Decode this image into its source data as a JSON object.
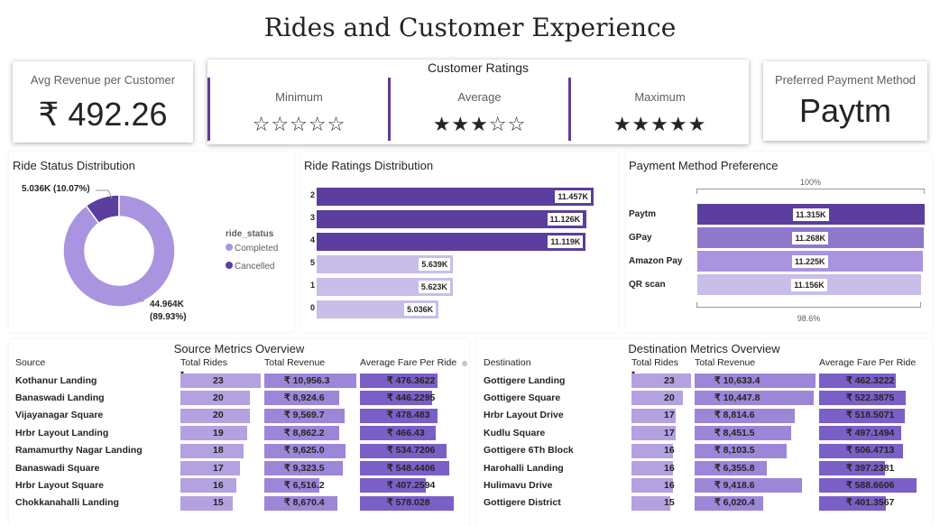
{
  "title": "Rides and Customer Experience",
  "kpi_revenue": {
    "label": "Avg Revenue per Customer",
    "value": "₹ 492.26"
  },
  "ratings": {
    "title": "Customer Ratings",
    "minimum": {
      "label": "Minimum",
      "stars": "☆☆☆☆☆",
      "rating": 0
    },
    "average": {
      "label": "Average",
      "stars": "★★★☆☆",
      "rating": 3
    },
    "maximum": {
      "label": "Maximum",
      "stars": "★★★★★",
      "rating": 5
    }
  },
  "kpi_payment": {
    "label": "Preferred Payment Method",
    "value": "Paytm"
  },
  "colors": {
    "accent": "#5e3c99",
    "dark": "#5b3e9e",
    "mid": "#8f77cc",
    "light": "#b3a1e0",
    "pale": "#c9bdea"
  },
  "chart_data": [
    {
      "type": "pie",
      "title": "Ride Status Distribution",
      "legend_title": "ride_status",
      "legend_position": "right",
      "slices": [
        {
          "name": "Completed",
          "value": 44964,
          "label": "44.964K",
          "pct": "(89.93%)",
          "color": "#a994e0"
        },
        {
          "name": "Cancelled",
          "value": 5036,
          "label": "5.036K (10.07%)",
          "color": "#5b3e9e"
        }
      ]
    },
    {
      "type": "bar",
      "title": "Ride Ratings Distribution",
      "orientation": "horizontal",
      "categories": [
        "2",
        "3",
        "4",
        "5",
        "1",
        "0"
      ],
      "values": [
        11457,
        11126,
        11119,
        5639,
        5623,
        5036
      ],
      "labels": [
        "11.457K",
        "11.126K",
        "11.119K",
        "5.639K",
        "5.623K",
        "5.036K"
      ],
      "colors": [
        "#5b3e9e",
        "#5b3e9e",
        "#5b3e9e",
        "#c9bdea",
        "#c9bdea",
        "#c9bdea"
      ],
      "xlim": [
        0,
        12000
      ]
    },
    {
      "type": "bar",
      "title": "Payment Method Preference",
      "orientation": "horizontal",
      "categories": [
        "Paytm",
        "GPay",
        "Amazon Pay",
        "QR scan"
      ],
      "values": [
        11315,
        11268,
        11225,
        11156
      ],
      "labels": [
        "11.315K",
        "11.268K",
        "11.225K",
        "11.156K"
      ],
      "colors": [
        "#5b3e9e",
        "#8f77cc",
        "#a994e0",
        "#c9bdea"
      ],
      "top_label": "100%",
      "bottom_label": "98.6%"
    },
    {
      "type": "table",
      "title": "Source Metrics Overview",
      "columns": [
        "Source",
        "Total Rides",
        "Total Revenue",
        "Average Fare Per Ride"
      ],
      "rows": [
        {
          "name": "Kothanur Landing",
          "rides": 23,
          "revenue": "₹ 10,956.3",
          "revenue_value": 10956.3,
          "fare": "₹ 476.3622",
          "fare_value": 476.3622
        },
        {
          "name": "Banaswadi Landing",
          "rides": 20,
          "revenue": "₹ 8,924.6",
          "revenue_value": 8924.6,
          "fare": "₹ 446.2295",
          "fare_value": 446.2295
        },
        {
          "name": "Vijayanagar Square",
          "rides": 20,
          "revenue": "₹ 9,569.7",
          "revenue_value": 9569.7,
          "fare": "₹ 478.483",
          "fare_value": 478.483
        },
        {
          "name": "Hrbr Layout Landing",
          "rides": 19,
          "revenue": "₹ 8,862.2",
          "revenue_value": 8862.2,
          "fare": "₹ 466.43",
          "fare_value": 466.43
        },
        {
          "name": "Ramamurthy Nagar Landing",
          "rides": 18,
          "revenue": "₹ 9,625.0",
          "revenue_value": 9625.0,
          "fare": "₹ 534.7206",
          "fare_value": 534.7206
        },
        {
          "name": "Banaswadi Square",
          "rides": 17,
          "revenue": "₹ 9,323.5",
          "revenue_value": 9323.5,
          "fare": "₹ 548.4406",
          "fare_value": 548.4406
        },
        {
          "name": "Hrbr Layout Square",
          "rides": 16,
          "revenue": "₹ 6,516.2",
          "revenue_value": 6516.2,
          "fare": "₹ 407.2594",
          "fare_value": 407.2594
        },
        {
          "name": "Chokkanahalli Landing",
          "rides": 15,
          "revenue": "₹ 8,670.4",
          "revenue_value": 8670.4,
          "fare": "₹ 578.028",
          "fare_value": 578.028
        }
      ]
    },
    {
      "type": "table",
      "title": "Destination Metrics Overview",
      "columns": [
        "Destination",
        "Total Rides",
        "Total Revenue",
        "Average Fare Per Ride"
      ],
      "rows": [
        {
          "name": "Gottigere Landing",
          "rides": 23,
          "revenue": "₹ 10,633.4",
          "revenue_value": 10633.4,
          "fare": "₹ 462.3222",
          "fare_value": 462.3222
        },
        {
          "name": "Gottigere Square",
          "rides": 20,
          "revenue": "₹ 10,447.8",
          "revenue_value": 10447.8,
          "fare": "₹ 522.3875",
          "fare_value": 522.3875
        },
        {
          "name": "Hrbr Layout Drive",
          "rides": 17,
          "revenue": "₹ 8,814.6",
          "revenue_value": 8814.6,
          "fare": "₹ 518.5071",
          "fare_value": 518.5071
        },
        {
          "name": "Kudlu Square",
          "rides": 17,
          "revenue": "₹ 8,451.5",
          "revenue_value": 8451.5,
          "fare": "₹ 497.1494",
          "fare_value": 497.1494
        },
        {
          "name": "Gottigere 6Th Block",
          "rides": 16,
          "revenue": "₹ 8,103.5",
          "revenue_value": 8103.5,
          "fare": "₹ 506.4713",
          "fare_value": 506.4713
        },
        {
          "name": "Harohalli Landing",
          "rides": 16,
          "revenue": "₹ 6,355.8",
          "revenue_value": 6355.8,
          "fare": "₹ 397.2381",
          "fare_value": 397.2381
        },
        {
          "name": "Hulimavu Drive",
          "rides": 16,
          "revenue": "₹ 9,418.6",
          "revenue_value": 9418.6,
          "fare": "₹ 588.6606",
          "fare_value": 588.6606
        },
        {
          "name": "Gottigere District",
          "rides": 15,
          "revenue": "₹ 6,020.4",
          "revenue_value": 6020.4,
          "fare": "₹ 401.3567",
          "fare_value": 401.3567
        }
      ]
    }
  ]
}
